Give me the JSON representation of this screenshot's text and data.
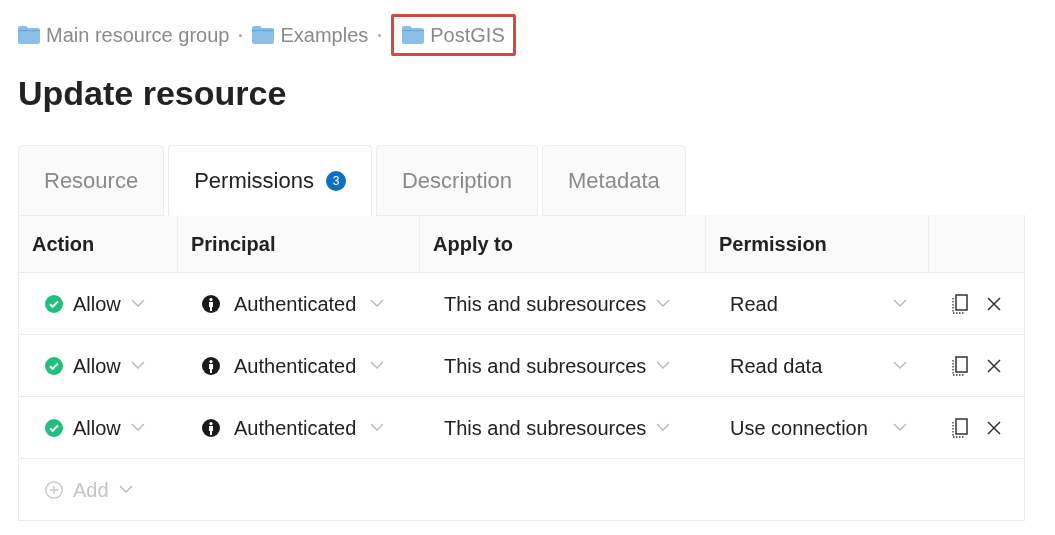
{
  "breadcrumb": [
    {
      "label": "Main resource group",
      "highlighted": false
    },
    {
      "label": "Examples",
      "highlighted": false
    },
    {
      "label": "PostGIS",
      "highlighted": true
    }
  ],
  "title": "Update resource",
  "tabs": [
    {
      "label": "Resource",
      "selected": false
    },
    {
      "label": "Permissions",
      "selected": true,
      "badge": "3"
    },
    {
      "label": "Description",
      "selected": false
    },
    {
      "label": "Metadata",
      "selected": false
    }
  ],
  "table": {
    "columns": [
      "Action",
      "Principal",
      "Apply to",
      "Permission"
    ],
    "rows": [
      {
        "action": "Allow",
        "principal": "Authenticated",
        "apply_to": "This and subresources",
        "permission": "Read"
      },
      {
        "action": "Allow",
        "principal": "Authenticated",
        "apply_to": "This and subresources",
        "permission": "Read data"
      },
      {
        "action": "Allow",
        "principal": "Authenticated",
        "apply_to": "This and subresources",
        "permission": "Use connection"
      }
    ],
    "add": {
      "label": "Add",
      "disabled": true
    }
  }
}
